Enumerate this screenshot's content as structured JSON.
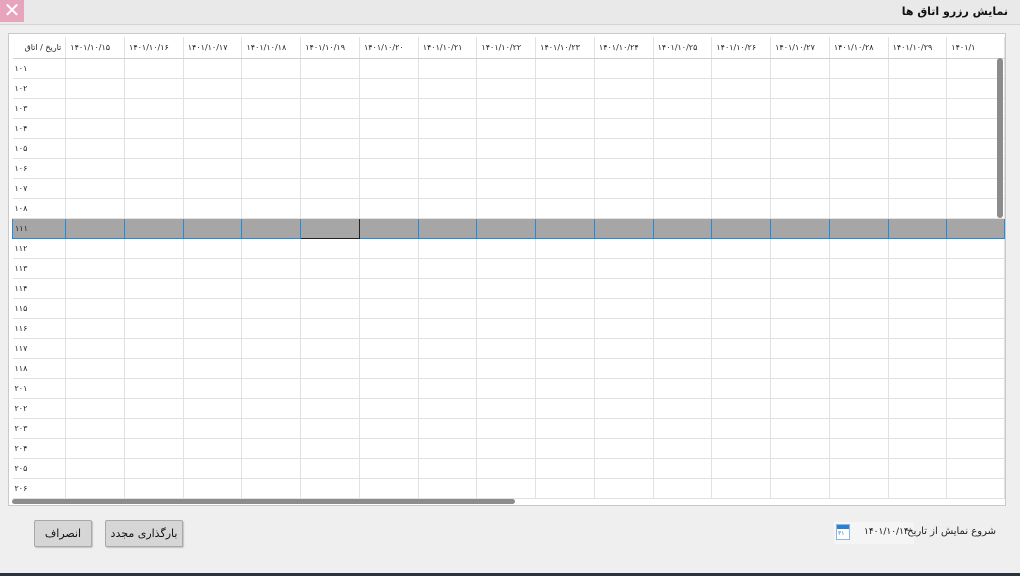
{
  "window": {
    "title": "نمایش رزرو اتاق ها",
    "close_glyph": "✕"
  },
  "grid": {
    "corner_header": "تاریخ / اتاق",
    "dates": [
      "۱۴۰۱/۱۰/۱۵",
      "۱۴۰۱/۱۰/۱۶",
      "۱۴۰۱/۱۰/۱۷",
      "۱۴۰۱/۱۰/۱۸",
      "۱۴۰۱/۱۰/۱۹",
      "۱۴۰۱/۱۰/۲۰",
      "۱۴۰۱/۱۰/۲۱",
      "۱۴۰۱/۱۰/۲۲",
      "۱۴۰۱/۱۰/۲۳",
      "۱۴۰۱/۱۰/۲۴",
      "۱۴۰۱/۱۰/۲۵",
      "۱۴۰۱/۱۰/۲۶",
      "۱۴۰۱/۱۰/۲۷",
      "۱۴۰۱/۱۰/۲۸",
      "۱۴۰۱/۱۰/۲۹",
      "۱۴۰۱/۱"
    ],
    "rooms": [
      "۱۰۱",
      "۱۰۲",
      "۱۰۳",
      "۱۰۴",
      "۱۰۵",
      "۱۰۶",
      "۱۰۷",
      "۱۰۸",
      "۱۱۱",
      "۱۱۲",
      "۱۱۳",
      "۱۱۴",
      "۱۱۵",
      "۱۱۶",
      "۱۱۷",
      "۱۱۸",
      "۲۰۱",
      "۲۰۲",
      "۲۰۳",
      "۲۰۴",
      "۲۰۵",
      "۲۰۶"
    ],
    "selected_room": "۱۱۱",
    "selected_date": "۱۴۰۱/۱۰/۱۹"
  },
  "footer": {
    "start_date_label": "شروع نمایش از تاریخ",
    "start_date_value": "۱۴۰۱/۱۰/۱۴",
    "calendar_icon_text": "۳۱",
    "reload_label": "بارگذاری مجدد",
    "cancel_label": "انصراف"
  },
  "colors": {
    "selection_fill": "#a6a6a6",
    "selection_border": "#1f8ce0",
    "close_button": "#e8a3bd"
  }
}
